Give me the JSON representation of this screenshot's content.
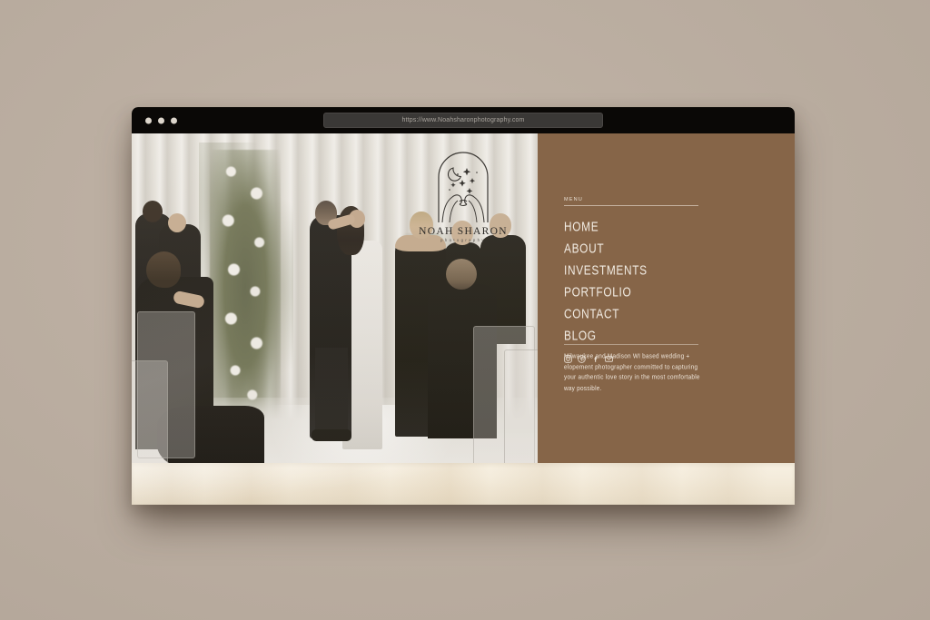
{
  "browser": {
    "url": "https://www.Noahsharonphotography.com",
    "traffic_lights": [
      "close-dot",
      "minimize-dot",
      "maximize-dot"
    ],
    "dot_color": "#ddd6cc",
    "titlebar_color": "#0a0806"
  },
  "logo": {
    "mark_name": "arch-moon-stars-pinky-promise-hands",
    "wordmark": "NOAH SHARON",
    "subtext": "photography"
  },
  "hero": {
    "alt": "Bride and groom sharing a kiss at a wedding ceremony with floral arch and seated guests",
    "scene_elements": [
      "white drapery backdrop",
      "white rose and greenery floral installation",
      "bride in white gown",
      "groom in black tuxedo",
      "bridesmaids in black gowns",
      "clear chiavari chairs",
      "glossy white dance floor",
      "dried petals"
    ]
  },
  "sidebar": {
    "background_color": "#866548",
    "menu_label": "MENU",
    "nav_items": [
      {
        "label": "HOME"
      },
      {
        "label": "ABOUT"
      },
      {
        "label": "INVESTMENTS"
      },
      {
        "label": "PORTFOLIO"
      },
      {
        "label": "CONTACT"
      },
      {
        "label": "BLOG"
      }
    ],
    "social": [
      {
        "name": "instagram-icon"
      },
      {
        "name": "pinterest-icon"
      },
      {
        "name": "facebook-icon"
      },
      {
        "name": "email-icon"
      }
    ],
    "tagline": "Milwaukee and Madison WI based wedding + elopement photographer committed to capturing your authentic love story in the most comfortable way possible.",
    "text_color": "#f2ece3"
  },
  "paper_band": {
    "name": "crinkled-paper-footer",
    "color": "#f4ecdc"
  },
  "backdrop": {
    "color": "#bdb0a3"
  }
}
